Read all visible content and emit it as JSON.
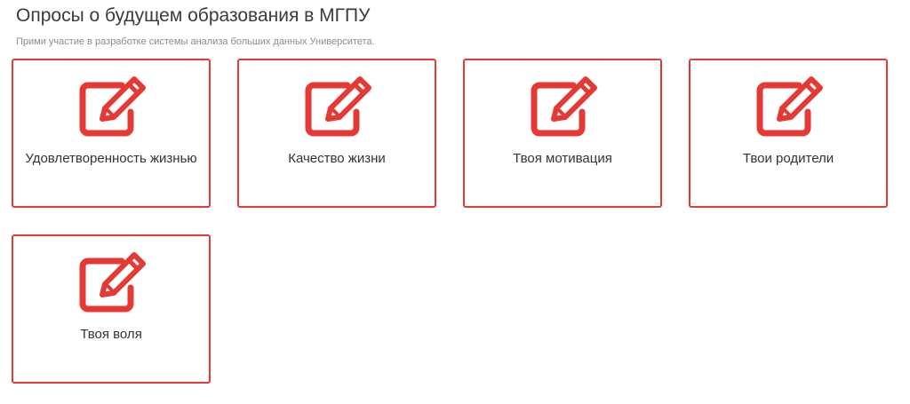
{
  "header": {
    "title": "Опросы о будущем образования в МГПУ",
    "subtitle": "Прими участие в разработке системы анализа больших данных Университета."
  },
  "theme": {
    "accent": "#e53935"
  },
  "surveys": [
    {
      "label": "Удовлетворенность жизнью",
      "icon": "edit-icon"
    },
    {
      "label": "Качество жизни",
      "icon": "edit-icon"
    },
    {
      "label": "Твоя мотивация",
      "icon": "edit-icon"
    },
    {
      "label": "Твои родители",
      "icon": "edit-icon"
    },
    {
      "label": "Твоя воля",
      "icon": "edit-icon"
    }
  ]
}
